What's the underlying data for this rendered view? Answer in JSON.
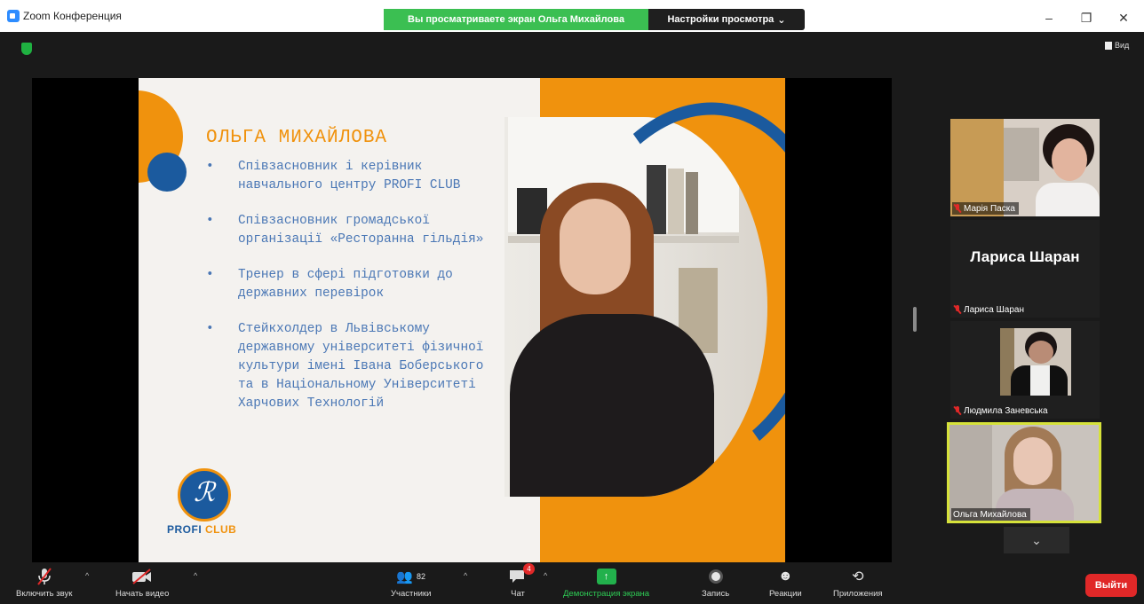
{
  "window": {
    "app_title": "Zoom Конференция",
    "share_banner": "Вы просматриваете экран Ольга Михайлова",
    "view_options": "Настройки просмотра",
    "minimize": "–",
    "restore": "❐",
    "close": "✕"
  },
  "meeting": {
    "view_label": "Вид"
  },
  "slide": {
    "name": "ОЛЬГА МИХАЙЛОВА",
    "bullets": [
      "Співзасновник і керівник навчального центру PROFI CLUB",
      "Співзасновник громадської організації «Ресторанна гільдія»",
      "Тренер в сфері підготовки до державних перевірок",
      "Стейкхолдер в Львівському державному університеті фізичної культури імені Івана Боберського та в Національному Університеті Харчових Технологій"
    ],
    "bullet_glyph": "•",
    "logo_text_profi": "PROFI",
    "logo_text_club": "CLUB",
    "colors": {
      "orange": "#f0920d",
      "blue": "#1b5a9e",
      "text_blue": "#4a77b5"
    }
  },
  "participants": [
    {
      "name": "Марія Паска",
      "muted": true
    },
    {
      "name": "Лариса Шаран",
      "big_name": "Лариса Шаран",
      "muted": true
    },
    {
      "name": "Людмила Заневська",
      "muted": true
    },
    {
      "name": "Ольга Михайлова",
      "muted": false,
      "active_speaker": true
    }
  ],
  "gallery": {
    "more_glyph": "⌄"
  },
  "toolbar": {
    "unmute": "Включить звук",
    "start_video": "Начать видео",
    "participants": "Участники",
    "participants_count": "82",
    "chat": "Чат",
    "chat_badge": "4",
    "share_screen": "Демонстрация экрана",
    "record": "Запись",
    "reactions": "Реакции",
    "apps": "Приложения",
    "leave": "Выйти",
    "caret": "^"
  }
}
